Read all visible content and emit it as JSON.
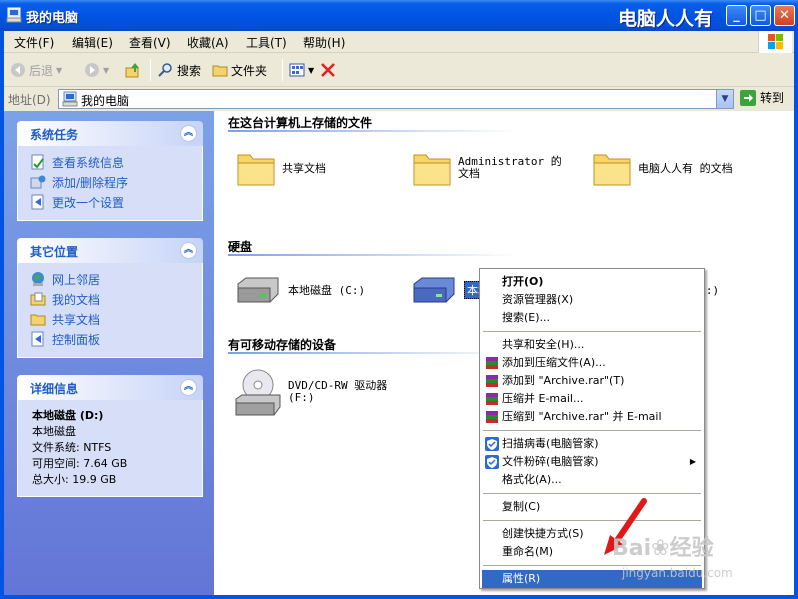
{
  "window": {
    "title": "我的电脑",
    "watermark": "电脑人人有",
    "min": "_",
    "max": "□",
    "close": "✕"
  },
  "menubar": [
    {
      "label": "文件(F)"
    },
    {
      "label": "编辑(E)"
    },
    {
      "label": "查看(V)"
    },
    {
      "label": "收藏(A)"
    },
    {
      "label": "工具(T)"
    },
    {
      "label": "帮助(H)"
    }
  ],
  "toolbar": {
    "back": "后退",
    "search": "搜索",
    "folders": "文件夹"
  },
  "address": {
    "label": "地址(D)",
    "value": "我的电脑",
    "go": "转到"
  },
  "tasks": {
    "title": "系统任务",
    "items": [
      {
        "label": "查看系统信息"
      },
      {
        "label": "添加/删除程序"
      },
      {
        "label": "更改一个设置"
      }
    ]
  },
  "places": {
    "title": "其它位置",
    "items": [
      {
        "label": "网上邻居"
      },
      {
        "label": "我的文档"
      },
      {
        "label": "共享文档"
      },
      {
        "label": "控制面板"
      }
    ]
  },
  "details": {
    "title": "详细信息",
    "name": "本地磁盘 (D:)",
    "type": "本地磁盘",
    "fs": "文件系统: NTFS",
    "free": "可用空间: 7.64 GB",
    "total": "总大小: 19.9 GB"
  },
  "sections": {
    "files": "在这台计算机上存储的文件",
    "disks": "硬盘",
    "removable": "有可移动存储的设备"
  },
  "file_items": [
    {
      "label": "共享文档"
    },
    {
      "label": "Administrator 的文档"
    },
    {
      "label": "电脑人人有 的文档"
    }
  ],
  "disk_items": [
    {
      "label": "本地磁盘 (C:)"
    },
    {
      "label": "本地磁盘 (D:)"
    },
    {
      "label": "备份资料 (E:)"
    }
  ],
  "removable_items": [
    {
      "label": "DVD/CD-RW 驱动器 (F:)"
    }
  ],
  "context_menu": [
    {
      "label": "打开(O)"
    },
    {
      "label": "资源管理器(X)"
    },
    {
      "label": "搜索(E)..."
    },
    {
      "label": "共享和安全(H)..."
    },
    {
      "label": "添加到压缩文件(A)..."
    },
    {
      "label": "添加到 \"Archive.rar\"(T)"
    },
    {
      "label": "压缩并 E-mail..."
    },
    {
      "label": "压缩到 \"Archive.rar\" 并 E-mail"
    },
    {
      "label": "扫描病毒(电脑管家)"
    },
    {
      "label": "文件粉碎(电脑管家)"
    },
    {
      "label": "格式化(A)..."
    },
    {
      "label": "复制(C)"
    },
    {
      "label": "创建快捷方式(S)"
    },
    {
      "label": "重命名(M)"
    },
    {
      "label": "属性(R)"
    }
  ],
  "watermark": {
    "brand": "Bai❀经验",
    "url": "jingyan.baidu.com"
  },
  "colors": {
    "accent": "#316ac5",
    "title_blue": "#0054e3",
    "link_blue": "#215dc6"
  }
}
